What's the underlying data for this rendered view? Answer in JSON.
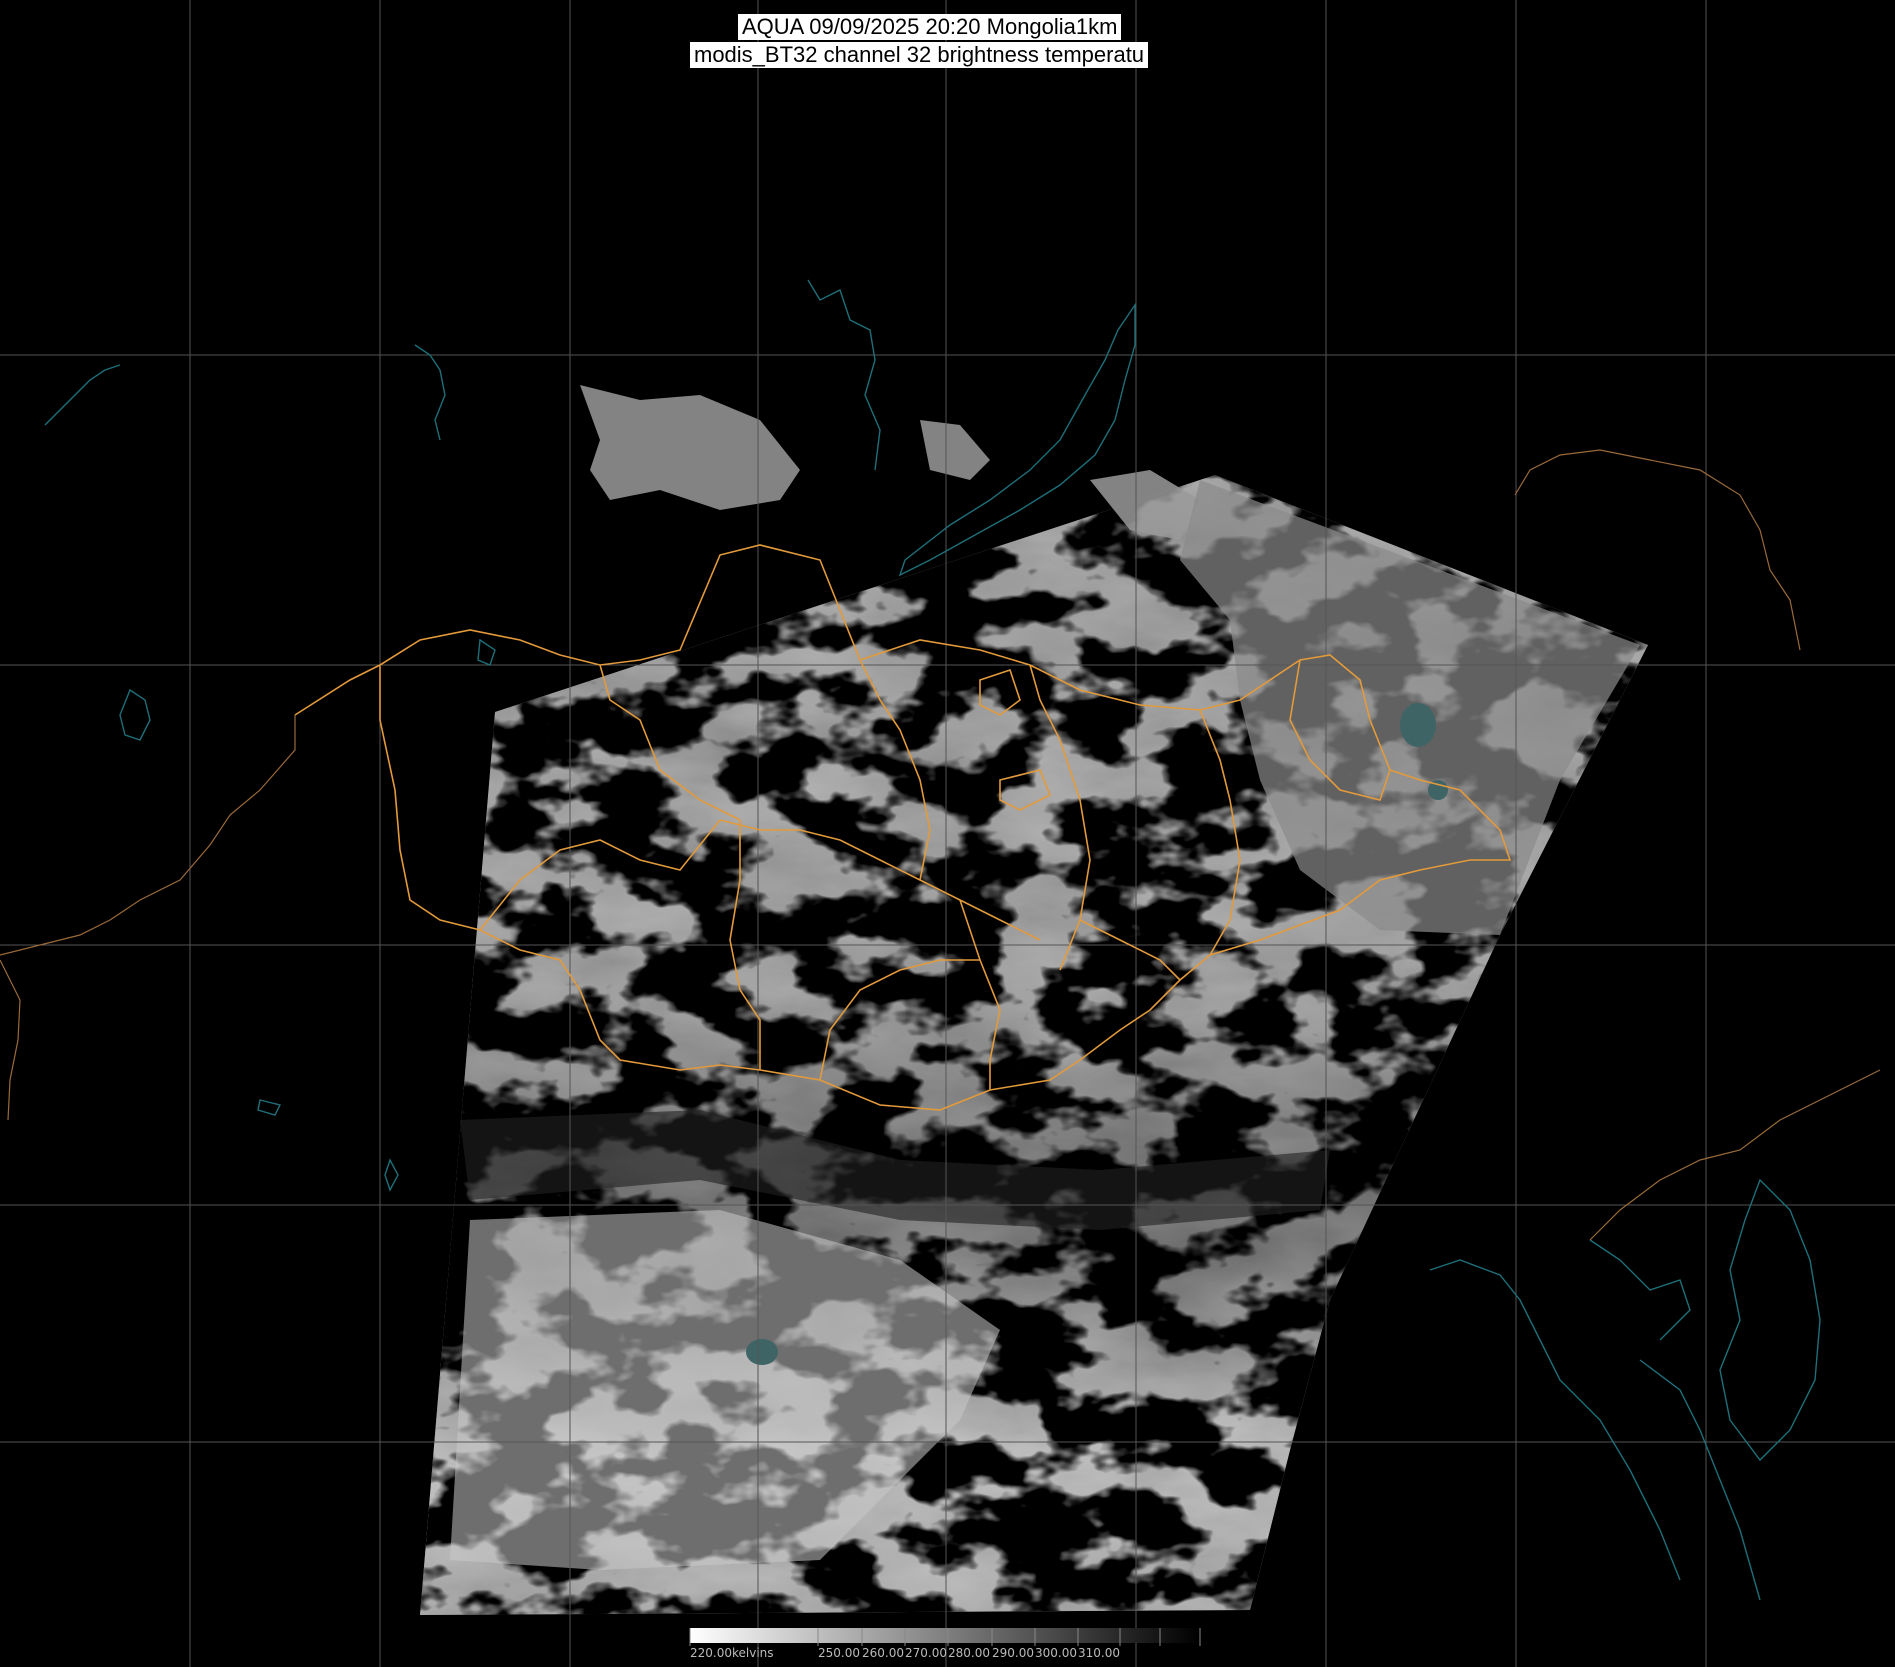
{
  "header": {
    "line1": "AQUA 09/09/2025 20:20 Mongolia1km",
    "line2": "modis_BT32 channel 32 brightness temperatu"
  },
  "colorbar": {
    "labels": [
      "220.00kelvins",
      "250.00",
      "260.00",
      "270.00",
      "280.00",
      "290.00",
      "300.00",
      "310.00"
    ],
    "min_kelvin": 220,
    "max_kelvin": 310,
    "colors": {
      "cold": "#ffffff",
      "warm": "#000000"
    }
  },
  "colors": {
    "background": "#000000",
    "gridlines": "#555555",
    "national_borders": "#e39a3b",
    "coastlines_lakes": "#1f6f7a",
    "other_borders": "#9a6a3a"
  }
}
